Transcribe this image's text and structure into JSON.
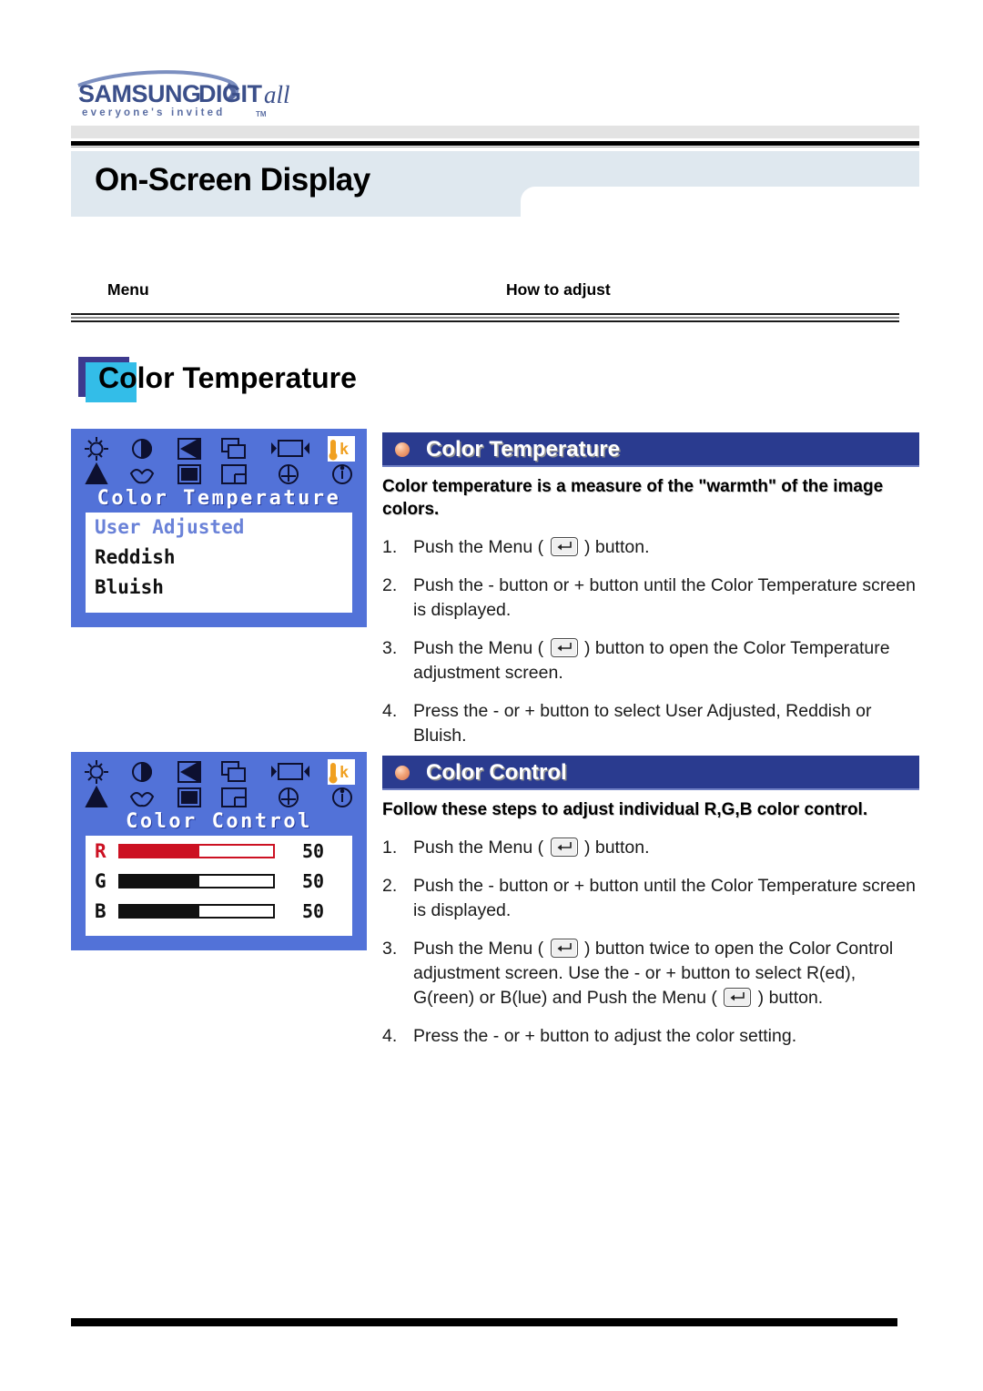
{
  "brand": {
    "name": "SAMSUNG DIGITall",
    "tagline": "everyone's invited",
    "tagline_tm": "TM"
  },
  "page_title": "On-Screen Display",
  "columns": {
    "menu_header": "Menu",
    "adjust_header": "How to adjust"
  },
  "section_heading": "Color Temperature",
  "osd_screens": [
    {
      "title": "Color Temperature",
      "type": "list",
      "items": [
        {
          "label": "User Adjusted",
          "selected": true
        },
        {
          "label": "Reddish",
          "selected": false
        },
        {
          "label": "Bluish",
          "selected": false
        }
      ]
    },
    {
      "title": "Color Control",
      "type": "sliders",
      "sliders": [
        {
          "label": "R",
          "value": "50",
          "percent": 52,
          "color": "#cc1122"
        },
        {
          "label": "G",
          "value": "50",
          "percent": 52,
          "color": "#111111"
        },
        {
          "label": "B",
          "value": "50",
          "percent": 52,
          "color": "#111111"
        }
      ]
    }
  ],
  "blocks": [
    {
      "bar_title": "Color Temperature",
      "lead": "Color temperature is a measure of the \"warmth\" of the image colors.",
      "steps": [
        {
          "pre": "Push the Menu (",
          "has_icon": true,
          "post": ") button."
        },
        {
          "pre": "Push the - button or + button until the Color Temperature screen is displayed.",
          "has_icon": false,
          "post": ""
        },
        {
          "pre": "Push the Menu (",
          "has_icon": true,
          "post": ") button to open the Color Temperature adjustment screen."
        },
        {
          "pre": "Press the - or + button to select User Adjusted, Reddish or Bluish.",
          "has_icon": false,
          "post": ""
        }
      ]
    },
    {
      "bar_title": "Color Control",
      "lead": "Follow these steps to adjust individual R,G,B color control.",
      "steps": [
        {
          "pre": "Push the Menu (",
          "has_icon": true,
          "post": ") button."
        },
        {
          "pre": "Push the - button or + button until the Color Temperature screen is displayed.",
          "has_icon": false,
          "post": ""
        },
        {
          "pre": "Push the Menu (",
          "has_icon": true,
          "post": ") button twice to open the Color Control adjustment screen.",
          "pre2": "Use the - or + button to select R(ed), G(reen) or B(lue) and Push the Menu (",
          "has_icon2": true,
          "post2": ") button."
        },
        {
          "pre": "Press the - or + button to adjust the color setting.",
          "has_icon": false,
          "post": ""
        }
      ]
    }
  ],
  "colors": {
    "osd_blue": "#5272d8",
    "bar_navy": "#2a3b8f",
    "accent_cyan": "#33bde8",
    "accent_purple": "#3d3a8e",
    "title_band": "#dfe8ef",
    "bullet_orange": "#e8895c"
  },
  "icon_names": [
    "brightness-icon",
    "contrast-icon",
    "sharpness-icon",
    "h-position-icon",
    "h-size-icon",
    "color-temperature-icon",
    "moire-icon",
    "color-control-icon",
    "pincushion-icon",
    "v-position-icon",
    "degauss-icon",
    "information-icon"
  ]
}
